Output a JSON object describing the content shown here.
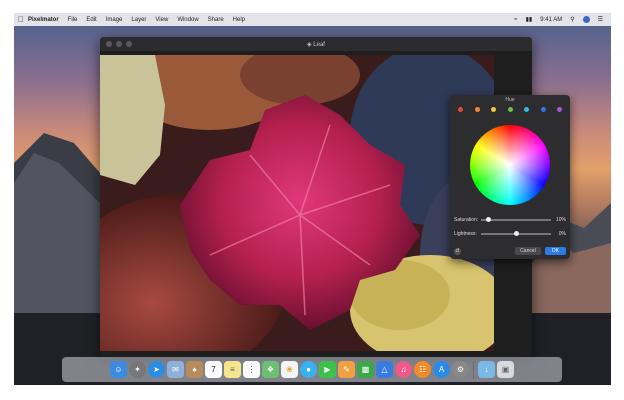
{
  "menubar": {
    "app_name": "Pixelmator",
    "items": [
      "File",
      "Edit",
      "Image",
      "Layer",
      "View",
      "Window",
      "Share",
      "Help"
    ],
    "clock": "9:41 AM"
  },
  "window": {
    "title": "Leaf"
  },
  "hue_panel": {
    "title": "Hue",
    "swatch_colors": [
      "#e14b44",
      "#f08a3a",
      "#f3c841",
      "#6cc24a",
      "#3fb6d8",
      "#3a6fe0",
      "#a05cd6"
    ],
    "saturation_label": "Saturation:",
    "saturation_value": "10%",
    "saturation_level": 0.1,
    "lightness_label": "Lightness:",
    "lightness_value": "0%",
    "lightness_level": 0.5,
    "cancel_label": "Cancel",
    "ok_label": "OK"
  },
  "dock": {
    "calendar_day": "7",
    "icons": [
      "finder-icon",
      "launchpad-icon",
      "safari-icon",
      "mail-icon",
      "contacts-icon",
      "calendar-icon",
      "notes-icon",
      "reminders-icon",
      "maps-icon",
      "photos-icon",
      "messages-icon",
      "facetime-icon",
      "pages-icon",
      "numbers-icon",
      "keynote-icon",
      "itunes-icon",
      "ibooks-icon",
      "app-store-icon",
      "system-preferences-icon",
      "downloads-folder-icon",
      "trash-icon"
    ]
  }
}
